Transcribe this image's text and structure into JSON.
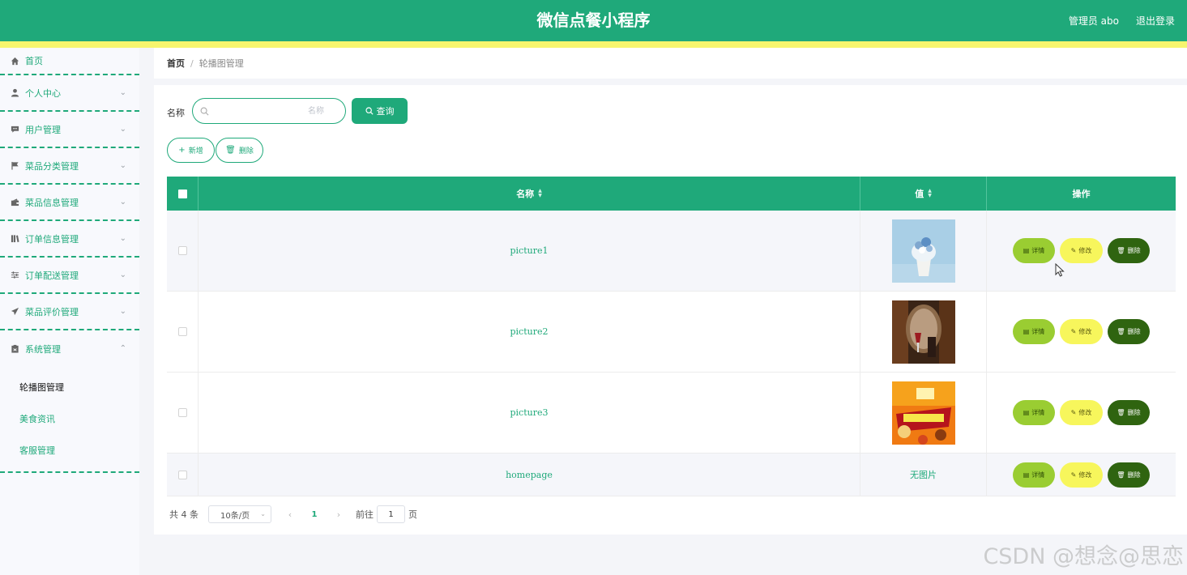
{
  "header": {
    "title": "微信点餐小程序",
    "user": "管理员 abo",
    "logout": "退出登录",
    "color": "#1fa97a",
    "stripe_color": "#f6f56e"
  },
  "sidebar": {
    "items": [
      {
        "label": "首页",
        "icon": "home-icon"
      },
      {
        "label": "个人中心",
        "icon": "person-icon"
      },
      {
        "label": "用户管理",
        "icon": "chat-icon"
      },
      {
        "label": "菜品分类管理",
        "icon": "flag-icon"
      },
      {
        "label": "菜品信息管理",
        "icon": "wallet-icon"
      },
      {
        "label": "订单信息管理",
        "icon": "books-icon"
      },
      {
        "label": "订单配送管理",
        "icon": "sliders-icon"
      },
      {
        "label": "菜品评价管理",
        "icon": "paper-plane-icon"
      },
      {
        "label": "系统管理",
        "icon": "clipboard-icon"
      }
    ],
    "system_sub": [
      {
        "label": "轮播图管理",
        "active": true
      },
      {
        "label": "美食资讯",
        "active": false
      },
      {
        "label": "客服管理",
        "active": false
      }
    ]
  },
  "breadcrumb": {
    "home": "首页",
    "separator": "/",
    "current": "轮播图管理"
  },
  "search": {
    "label": "名称",
    "placeholder": "名称",
    "value": "",
    "button": "查询"
  },
  "toolbar": {
    "add": "新增",
    "delete": "删除"
  },
  "table": {
    "headers": {
      "name": "名称",
      "value": "值",
      "actions": "操作"
    },
    "rows": [
      {
        "name": "picture1",
        "image": "cupcake-image"
      },
      {
        "name": "picture2",
        "image": "bar-interior-image"
      },
      {
        "name": "picture3",
        "image": "promo-poster-image"
      },
      {
        "name": "homepage",
        "image": null,
        "no_image_text": "无图片"
      }
    ],
    "actions": {
      "detail": "详情",
      "edit": "修改",
      "delete": "删除"
    }
  },
  "pagination": {
    "total": "共 4 条",
    "page_size": "10条/页",
    "current_page": "1",
    "goto_label": "前往",
    "goto_value": "1",
    "page_suffix": "页"
  },
  "watermark": "CSDN @想念@思恋"
}
